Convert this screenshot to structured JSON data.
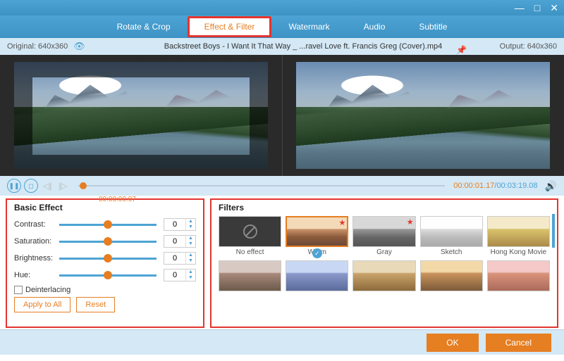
{
  "tabs": {
    "rotate": "Rotate & Crop",
    "effect": "Effect & Filter",
    "watermark": "Watermark",
    "audio": "Audio",
    "subtitle": "Subtitle"
  },
  "info": {
    "original": "Original: 640x360",
    "filename": "Backstreet Boys - I Want It That Way _ ...ravel Love ft. Francis Greg (Cover).mp4",
    "output": "Output: 640x360"
  },
  "playback": {
    "pos_time": "00:00:00.07",
    "current": "00:00:01.17",
    "total": "00:03:19.08"
  },
  "basic": {
    "heading": "Basic Effect",
    "contrast_label": "Contrast:",
    "saturation_label": "Saturation:",
    "brightness_label": "Brightness:",
    "hue_label": "Hue:",
    "contrast": "0",
    "saturation": "0",
    "brightness": "0",
    "hue": "0",
    "deinterlacing": "Deinterlacing",
    "apply_all": "Apply to All",
    "reset": "Reset"
  },
  "filters": {
    "heading": "Filters",
    "items": [
      "No effect",
      "Warm",
      "Gray",
      "Sketch",
      "Hong Kong Movie",
      "",
      "",
      "",
      "",
      ""
    ]
  },
  "footer": {
    "ok": "OK",
    "cancel": "Cancel"
  }
}
